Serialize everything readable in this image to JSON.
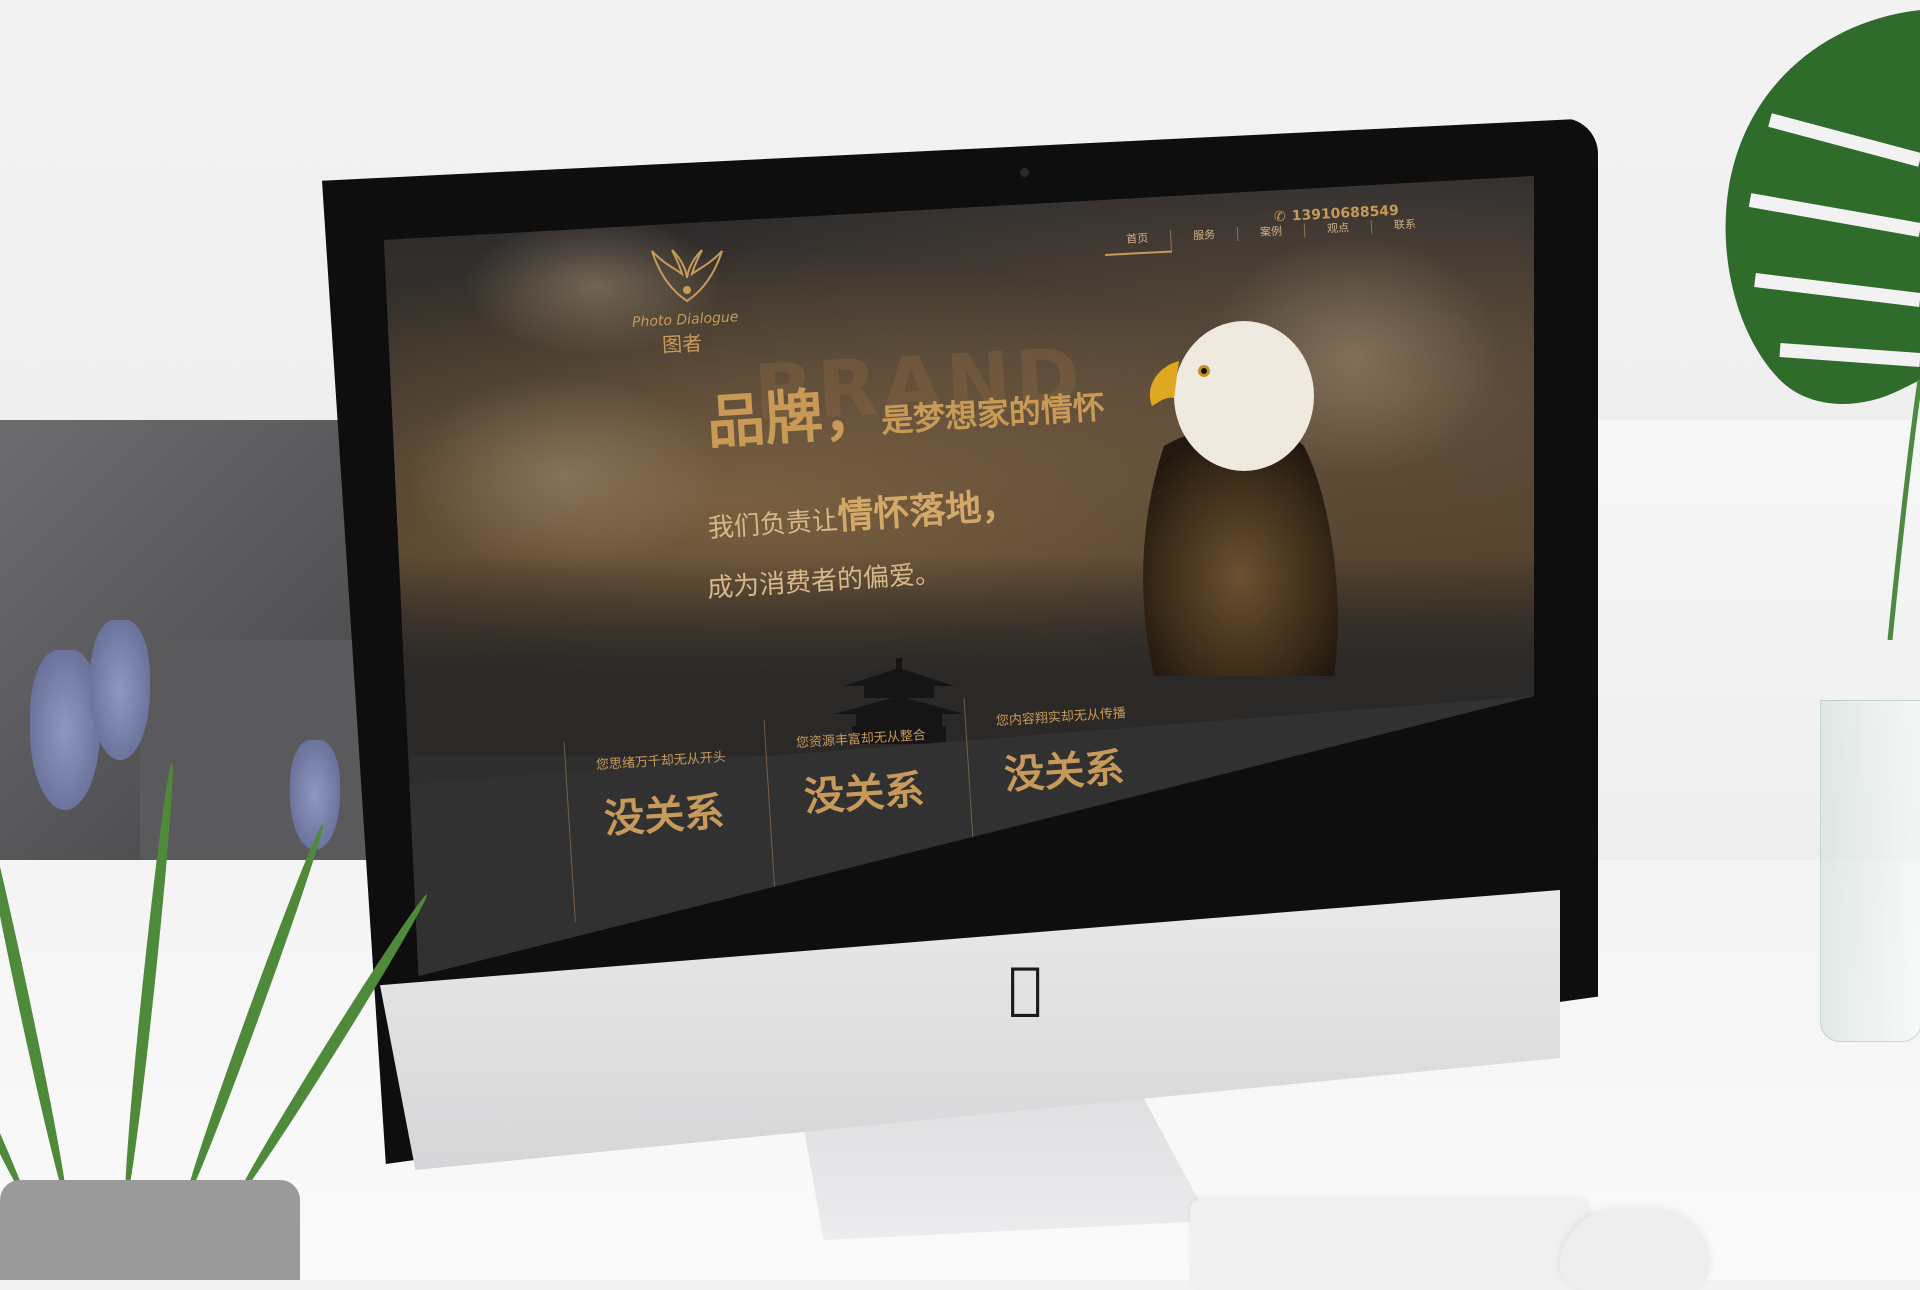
{
  "site": {
    "logo_en": "Photo Dialogue",
    "logo_cn": "图者",
    "phone": "13910688549",
    "nav": [
      "首页",
      "服务",
      "案例",
      "观点",
      "联系"
    ],
    "active_nav": "首页",
    "brand_watermark": "BRAND",
    "headline_big": "品牌，",
    "headline_small": "是梦想家的情怀",
    "sub1_plain": "我们负责让",
    "sub1_bold": "情怀落地，",
    "sub2": "成为消费者的偏爱。",
    "columns": [
      {
        "question": "您思绪万千却无从开头",
        "answer": "没关系"
      },
      {
        "question": "您资源丰富却无从整合",
        "answer": "没关系"
      },
      {
        "question": "您内容翔实却无从传播",
        "answer": "没关系"
      }
    ]
  },
  "colors": {
    "accent_gold": "#c79a5a",
    "screen_dark": "#2e2e2f",
    "bezel": "#0e0e0e"
  },
  "icons": [
    "phone-icon",
    "apple-logo-icon",
    "eagle-logo-icon"
  ]
}
